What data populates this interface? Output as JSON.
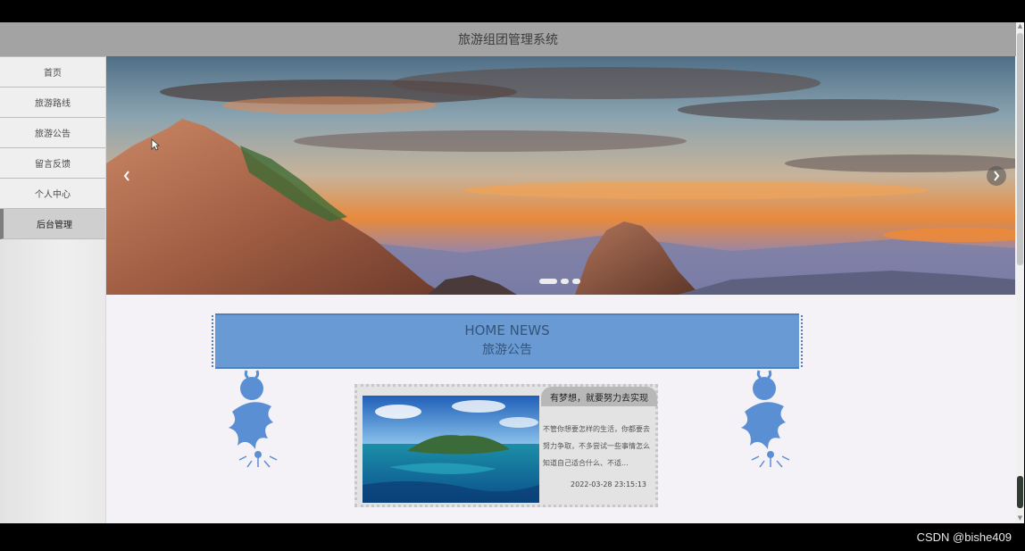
{
  "app": {
    "title": "旅游组团管理系统"
  },
  "sidebar": {
    "items": [
      {
        "label": "首页"
      },
      {
        "label": "旅游路线"
      },
      {
        "label": "旅游公告"
      },
      {
        "label": "留言反馈"
      },
      {
        "label": "个人中心"
      },
      {
        "label": "后台管理",
        "active": true
      }
    ]
  },
  "carousel": {
    "prev_icon": "chevron-left-icon",
    "next_icon": "chevron-right-icon",
    "slide_count": 3,
    "active_index": 0
  },
  "news": {
    "heading_en": "HOME NEWS",
    "heading_cn": "旅游公告",
    "card": {
      "title": "有梦想，就要努力去实现",
      "excerpt": "不管你想要怎样的生活，你都要去努力争取，不多尝试一些事情怎么知道自己适合什么、不适...",
      "date": "2022-03-28 23:15:13"
    }
  },
  "watermark": "CSDN @bishe409",
  "colors": {
    "topbar": "#a3a3a3",
    "accent": "#6a9ad4",
    "background": "#f4f2f6"
  }
}
